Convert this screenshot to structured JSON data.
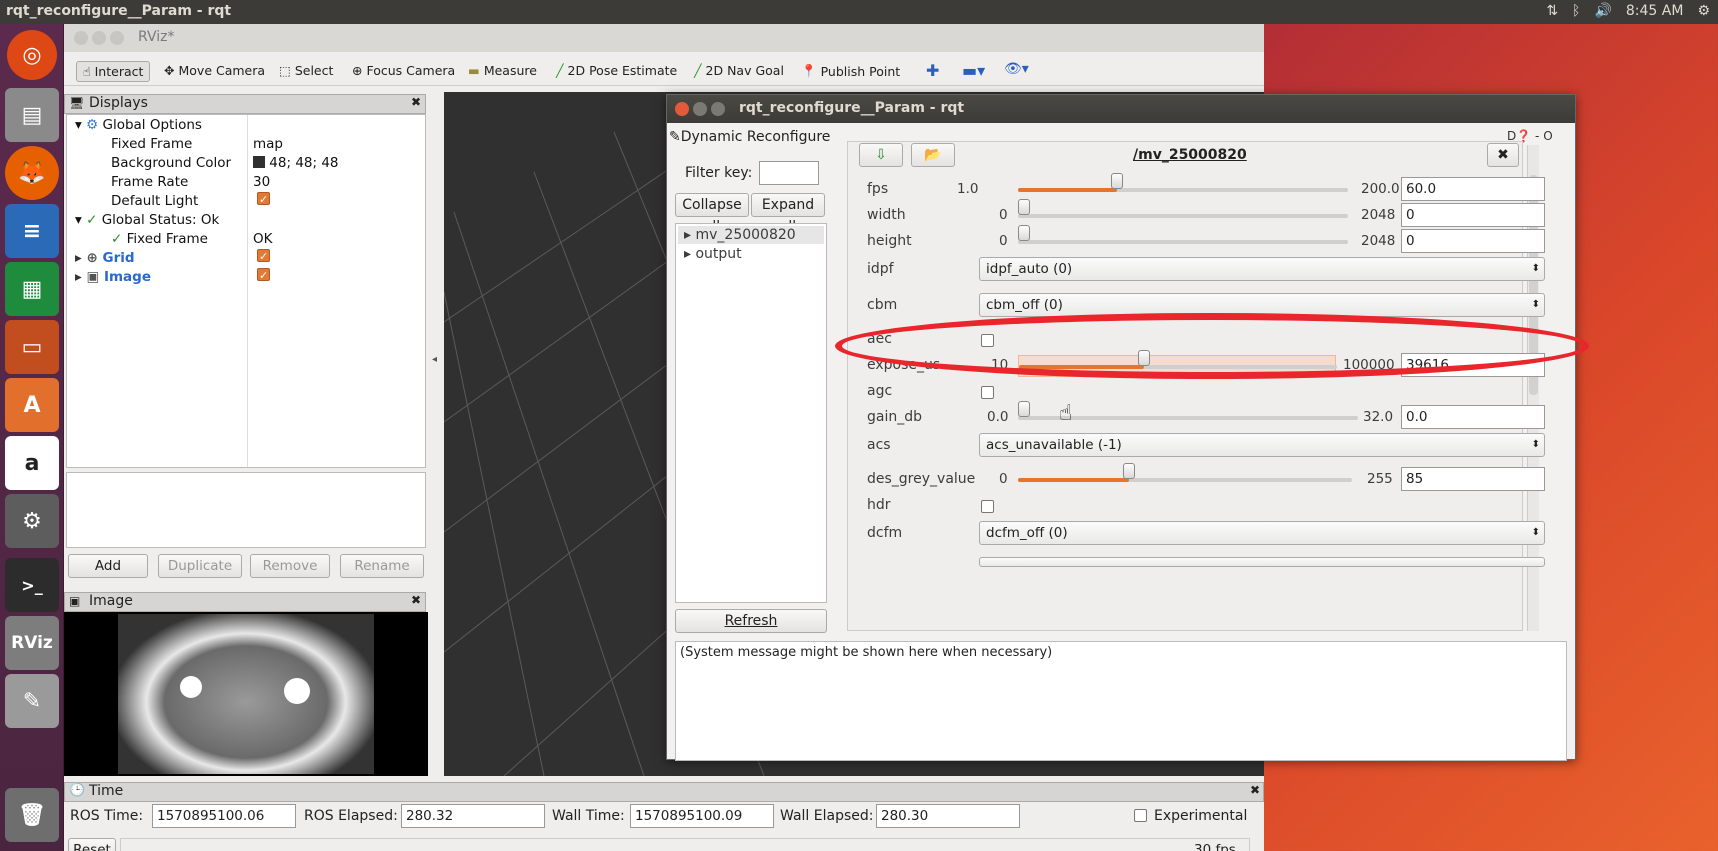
{
  "topbar": {
    "title": "rqt_reconfigure__Param - rqt",
    "time": "8:45 AM"
  },
  "launcher": {
    "items": [
      "ubuntu-logo",
      "files",
      "firefox",
      "writer",
      "calc",
      "impress",
      "software-center",
      "amazon",
      "system-settings",
      "terminal",
      "rviz",
      "text-editor",
      "trash"
    ]
  },
  "rviz": {
    "title": "RViz*",
    "toolbar": [
      "Interact",
      "Move Camera",
      "Select",
      "Focus Camera",
      "Measure",
      "2D Pose Estimate",
      "2D Nav Goal",
      "Publish Point"
    ],
    "displays_title": "Displays",
    "tree": {
      "global_options": "Global Options",
      "fixed_frame_label": "Fixed Frame",
      "fixed_frame_value": "map",
      "bg_color_label": "Background Color",
      "bg_color_value": "48; 48; 48",
      "frame_rate_label": "Frame Rate",
      "frame_rate_value": "30",
      "default_light_label": "Default Light",
      "global_status": "Global Status: Ok",
      "status_fixed_frame": "Fixed Frame",
      "status_fixed_frame_value": "OK",
      "grid": "Grid",
      "image": "Image"
    },
    "buttons": {
      "add": "Add",
      "duplicate": "Duplicate",
      "remove": "Remove",
      "rename": "Rename"
    },
    "image_panel_title": "Image",
    "time_panel": {
      "title": "Time",
      "ros_time_label": "ROS Time:",
      "ros_time": "1570895100.06",
      "ros_elapsed_label": "ROS Elapsed:",
      "ros_elapsed": "280.32",
      "wall_time_label": "Wall Time:",
      "wall_time": "1570895100.09",
      "wall_elapsed_label": "Wall Elapsed:",
      "wall_elapsed": "280.30",
      "experimental": "Experimental",
      "reset": "Reset",
      "fps": "30 fps"
    }
  },
  "rqt": {
    "title": "rqt_reconfigure__Param - rqt",
    "plugin_title": "Dynamic Reconfigure",
    "filter_label": "Filter key:",
    "collapse_all": "Collapse all",
    "expand_all": "Expand all",
    "nodes": [
      "mv_25000820",
      "output"
    ],
    "refresh": "Refresh",
    "node_name": "/mv_25000820",
    "params": {
      "fps": {
        "label": "fps",
        "min": "1.0",
        "max": "200.0",
        "value": "60.0",
        "fraction": 0.3
      },
      "width": {
        "label": "width",
        "min": "0",
        "max": "2048",
        "value": "0",
        "fraction": 0
      },
      "height": {
        "label": "height",
        "min": "0",
        "max": "2048",
        "value": "0",
        "fraction": 0
      },
      "idpf": {
        "label": "idpf",
        "value": "idpf_auto (0)"
      },
      "cbm": {
        "label": "cbm",
        "value": "cbm_off (0)"
      },
      "aec": {
        "label": "aec"
      },
      "expose_us": {
        "label": "expose_us",
        "min": "10",
        "max": "100000",
        "value": "39616",
        "fraction": 0.396
      },
      "agc": {
        "label": "agc"
      },
      "gain_db": {
        "label": "gain_db",
        "min": "0.0",
        "max": "32.0",
        "value": "0.0",
        "fraction": 0
      },
      "acs": {
        "label": "acs",
        "value": "acs_unavailable (-1)"
      },
      "des_grey_value": {
        "label": "des_grey_value",
        "min": "0",
        "max": "255",
        "value": "85",
        "fraction": 0.333
      },
      "hdr": {
        "label": "hdr"
      },
      "dcfm": {
        "label": "dcfm",
        "value": "dcfm_off (0)"
      }
    },
    "system_message": "(System message might be shown here when necessary)"
  }
}
